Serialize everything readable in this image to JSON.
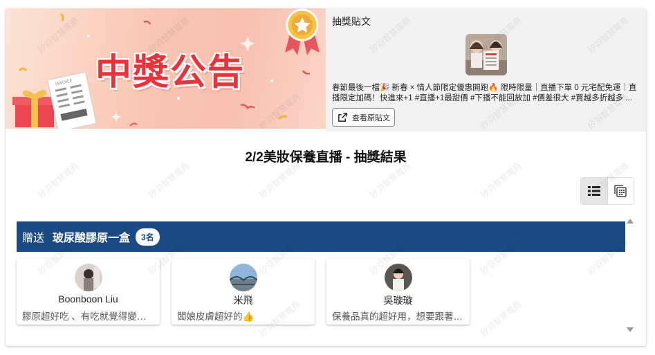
{
  "banner": {
    "title": "中獎公告",
    "invoice_label": "INVOICE"
  },
  "post": {
    "heading": "抽獎貼文",
    "text": "春節最後一檔🎉 新春 × 情人節限定優惠開跑🔥 限時限量｜直播下單 0 元宅配免運｜直播限定加碼！快進來+1 #直播+1最甜價 #下播不能回放加 #價差很大 #買越多折越多 ...",
    "view_button": "查看原貼文"
  },
  "result": {
    "title": "2/2美妝保養直播 - 抽獎結果"
  },
  "view_toggle": {
    "active": "list"
  },
  "prize": {
    "prefix": "贈送",
    "name": "玻尿酸膠原一盒",
    "count": "3名"
  },
  "winners": [
    {
      "name": "Boonboon Liu",
      "comment": "膠原超好吃 、有吃就覺得變漂亮了"
    },
    {
      "name": "米飛",
      "comment": "闆娘皮膚超好的👍"
    },
    {
      "name": "吳璇璇",
      "comment": "保養品真的超好用，想要跟著用用看"
    }
  ],
  "watermark_text": "矽羽智慧電商",
  "colors": {
    "prize_bar": "#1c4b84",
    "banner_title": "#e8333d"
  }
}
